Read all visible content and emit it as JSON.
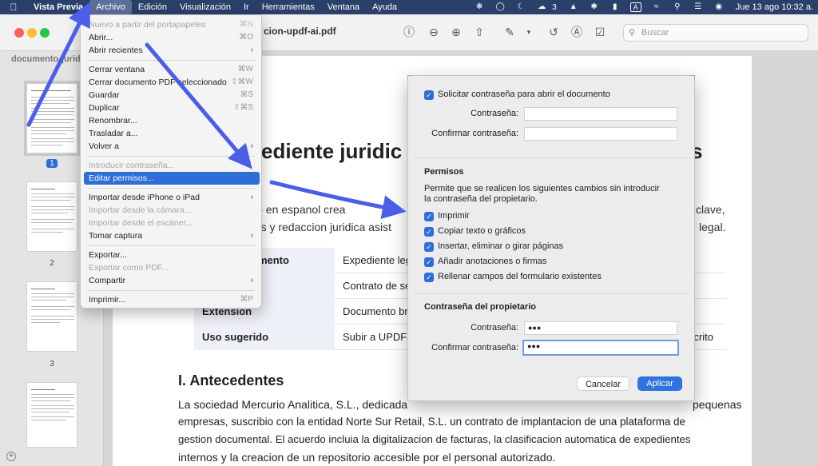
{
  "menubar": {
    "app_name": "Vista Previa",
    "items": [
      "Archivo",
      "Edición",
      "Visualización",
      "Ir",
      "Herramientas",
      "Ventana",
      "Ayuda"
    ],
    "status_count": "3",
    "input_badge": "A",
    "clock": "Jue 13 ago 10:32 a."
  },
  "window": {
    "title": "cion-updf-ai.pdf",
    "search_placeholder": "Buscar"
  },
  "sidebar": {
    "title": "documento-juridico",
    "pages": [
      "1",
      "2",
      "3"
    ]
  },
  "document": {
    "heading_left": "ediente juridic",
    "heading_right": "s",
    "intro_line1_left": "cio en espanol crea",
    "intro_line1_right": "clave,",
    "intro_line2_left": "bas y redaccion juridica asist",
    "intro_line2_right": "legal.",
    "table": [
      {
        "key": "umento",
        "value": "Expediente leg",
        "extra": ""
      },
      {
        "key": "",
        "value": "Contrato de se",
        "extra": ""
      },
      {
        "key": "Extension",
        "value": "Documento bre",
        "extra": ""
      },
      {
        "key": "Uso sugerido",
        "value": "Subir a UPDF A",
        "extra": "crito"
      }
    ],
    "section_title": "I. Antecedentes",
    "body_line1_left": "La sociedad Mercurio Analitica, S.L., dedicada",
    "body_line1_right": "pequenas",
    "body_line2": "empresas, suscribio con la entidad Norte Sur Retail, S.L. un contrato de implantacion de una plataforma de",
    "body_line3": "gestion documental. El acuerdo incluia la digitalizacion de facturas, la clasificacion automatica de expedientes",
    "body_line4": "internos y la creacion de un repositorio accesible por el personal autorizado."
  },
  "archivo_menu": {
    "items": [
      {
        "label": "Nuevo a partir del portapapeles",
        "shortcut": "⌘N"
      },
      {
        "label": "Abrir...",
        "shortcut": "⌘O"
      },
      {
        "label": "Abrir recientes",
        "shortcut": ""
      },
      {
        "label": "Cerrar ventana",
        "shortcut": "⌘W"
      },
      {
        "label": "Cerrar documento PDF seleccionado",
        "shortcut": "⇧⌘W"
      },
      {
        "label": "Guardar",
        "shortcut": "⌘S"
      },
      {
        "label": "Duplicar",
        "shortcut": "⇧⌘S"
      },
      {
        "label": "Renombrar...",
        "shortcut": ""
      },
      {
        "label": "Trasladar a...",
        "shortcut": ""
      },
      {
        "label": "Volver a",
        "shortcut": ""
      },
      {
        "label": "Introducir contraseña...",
        "shortcut": ""
      },
      {
        "label": "Editar permisos...",
        "shortcut": ""
      },
      {
        "label": "Importar desde iPhone o iPad",
        "shortcut": ""
      },
      {
        "label": "Importar desde la cámara...",
        "shortcut": ""
      },
      {
        "label": "Importar desde el escáner...",
        "shortcut": ""
      },
      {
        "label": "Tomar captura",
        "shortcut": ""
      },
      {
        "label": "Exportar...",
        "shortcut": ""
      },
      {
        "label": "Exportar como PDF...",
        "shortcut": ""
      },
      {
        "label": "Compartir",
        "shortcut": ""
      },
      {
        "label": "Imprimir...",
        "shortcut": "⌘P"
      }
    ]
  },
  "permissions_sheet": {
    "require_open_password_label": "Solicitar contraseña para abrir el documento",
    "password_label": "Contraseña:",
    "confirm_password_label": "Confirmar contraseña:",
    "permissions_heading": "Permisos",
    "permissions_desc_line1": "Permite que se realicen los siguientes cambios sin introducir",
    "permissions_desc_line2": "la contraseña del propietario.",
    "permissions": [
      "Imprimir",
      "Copiar texto o gráficos",
      "Insertar, eliminar o girar páginas",
      "Añadir anotaciones o firmas",
      "Rellenar campos del formulario existentes"
    ],
    "owner_heading": "Contraseña del propietario",
    "owner_password_value": "●●●",
    "owner_confirm_value": "●●●",
    "cancel_label": "Cancelar",
    "apply_label": "Aplicar"
  },
  "colors": {
    "menubar_bg": "#2a3f6a",
    "accent": "#2e6ed6",
    "annotation_arrow": "#4a5ee8"
  }
}
